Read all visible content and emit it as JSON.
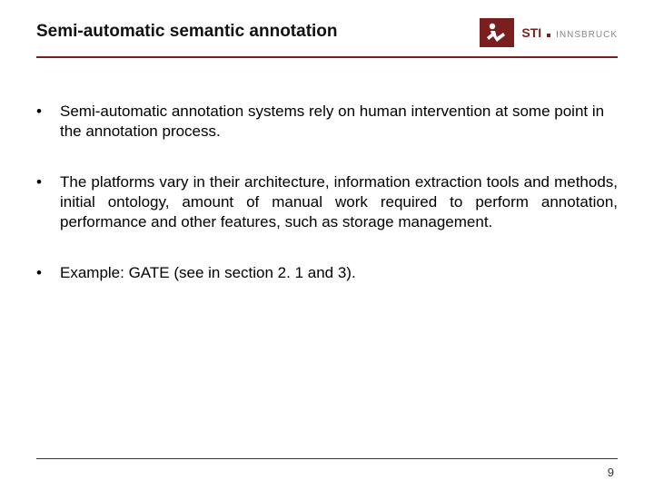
{
  "title": "Semi-automatic semantic annotation",
  "logo": {
    "sti": "STI",
    "location": "INNSBRUCK"
  },
  "bullets": [
    "Semi-automatic annotation systems rely on human intervention at some point in the annotation process.",
    "The platforms vary in their architecture, information extraction tools and methods, initial ontology, amount of manual work required to perform annotation, performance and other features, such as storage management.",
    "Example: GATE (see in section 2. 1 and 3)."
  ],
  "page_number": "9",
  "colors": {
    "brand": "#7a1f1f"
  }
}
